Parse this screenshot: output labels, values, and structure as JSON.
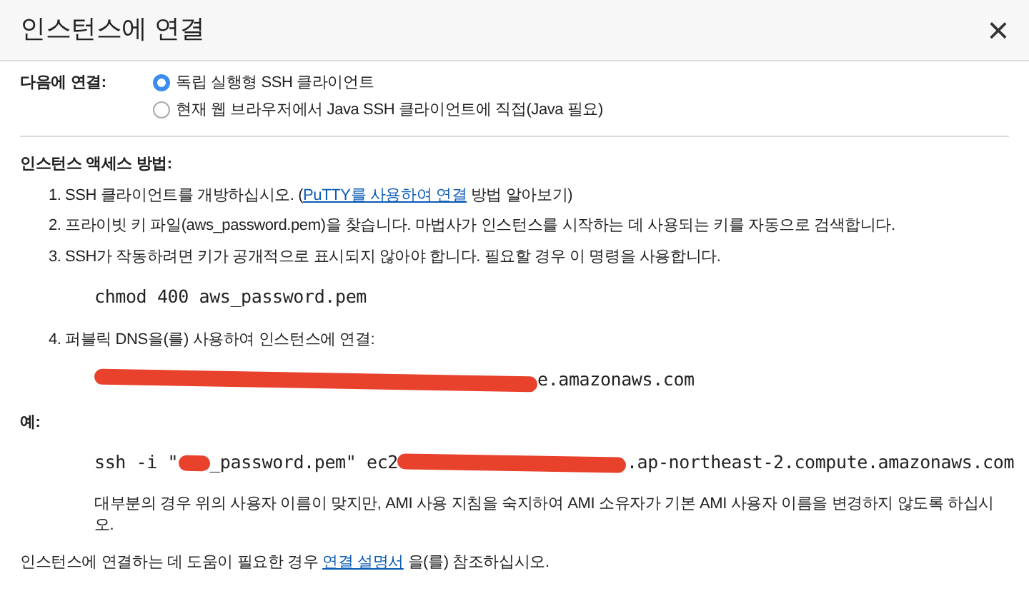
{
  "dialog": {
    "title": "인스턴스에 연결",
    "close": "×"
  },
  "connect": {
    "label": "다음에 연결:",
    "options": [
      {
        "label": "독립 실행형 SSH 클라이언트",
        "selected": true
      },
      {
        "label": "현재 웹 브라우저에서 Java SSH 클라이언트에 직접(Java 필요)",
        "selected": false
      }
    ]
  },
  "access": {
    "heading": "인스턴스 액세스 방법:",
    "steps": [
      {
        "number": "1.",
        "parts": [
          {
            "kind": "text",
            "text": "SSH 클라이언트를 개방하십시오. ("
          },
          {
            "kind": "link",
            "text": "PuTTY를 사용하여 연결"
          },
          {
            "kind": "text",
            "text": " 방법 알아보기)"
          }
        ]
      },
      {
        "number": "2.",
        "parts": [
          {
            "kind": "text",
            "text": "프라이빗 키 파일(aws_password.pem)을 찾습니다. 마법사가 인스턴스를 시작하는 데 사용되는 키를 자동으로 검색합니다."
          }
        ]
      },
      {
        "number": "3.",
        "parts": [
          {
            "kind": "text",
            "text": "SSH가 작동하려면 키가 공개적으로 표시되지 않아야 합니다. 필요할 경우 이 명령을 사용합니다."
          }
        ],
        "code": [
          {
            "kind": "text",
            "text": "chmod 400 aws_password.pem"
          }
        ]
      },
      {
        "number": "4.",
        "parts": [
          {
            "kind": "text",
            "text": "퍼블릭 DNS을(를) 사용하여 인스턴스에 연결:"
          }
        ],
        "code": [
          {
            "kind": "redacted"
          },
          {
            "kind": "text",
            "text": "e.amazonaws.com"
          }
        ]
      }
    ]
  },
  "example": {
    "heading": "예:",
    "code": [
      {
        "kind": "text",
        "text": "ssh -i \""
      },
      {
        "kind": "redacted"
      },
      {
        "kind": "text",
        "text": "_password.pem\" ec2"
      },
      {
        "kind": "redacted"
      },
      {
        "kind": "text",
        "text": ".ap-northeast-2.compute.amazonaws.com"
      }
    ],
    "note": "대부분의 경우 위의 사용자 이름이 맞지만, AMI 사용 지침을 숙지하여 AMI 소유자가 기본 AMI 사용자 이름을 변경하지 않도록 하십시오."
  },
  "footer": [
    {
      "kind": "text",
      "text": "인스턴스에 연결하는 데 도움이 필요한 경우 "
    },
    {
      "kind": "link",
      "text": "연결 설명서"
    },
    {
      "kind": "text",
      "text": " 을(를) 참조하십시오."
    }
  ]
}
